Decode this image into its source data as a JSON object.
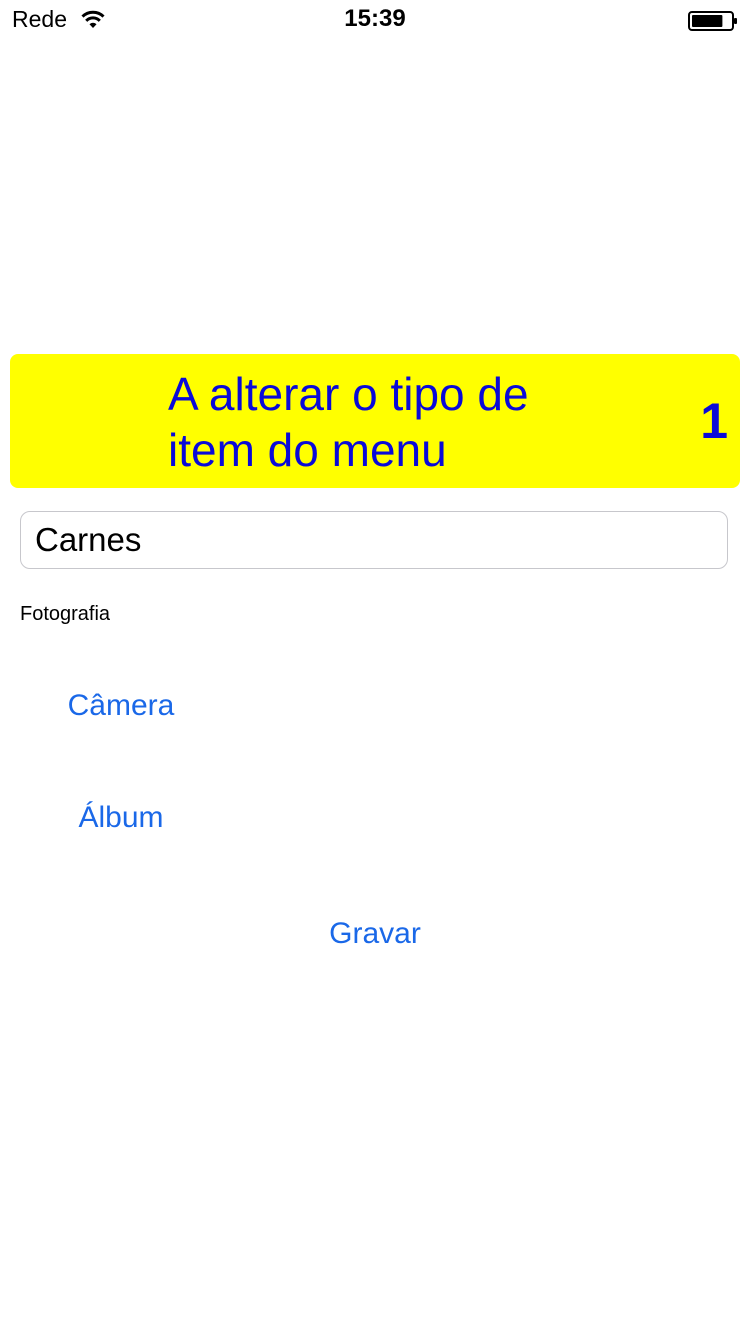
{
  "status_bar": {
    "carrier": "Rede",
    "time": "15:39",
    "wifi_icon": "wifi-icon",
    "battery_icon": "battery-icon",
    "battery_level": 0.8
  },
  "banner": {
    "title": "A alterar o tipo de item do menu",
    "count": "1",
    "background_color": "#ffff00",
    "text_color": "#0a0ad8"
  },
  "form": {
    "name_value": "Carnes",
    "photo_label": "Fotografia",
    "camera_label": "Câmera",
    "album_label": "Álbum",
    "save_label": "Gravar",
    "link_color": "#1a68e8"
  }
}
